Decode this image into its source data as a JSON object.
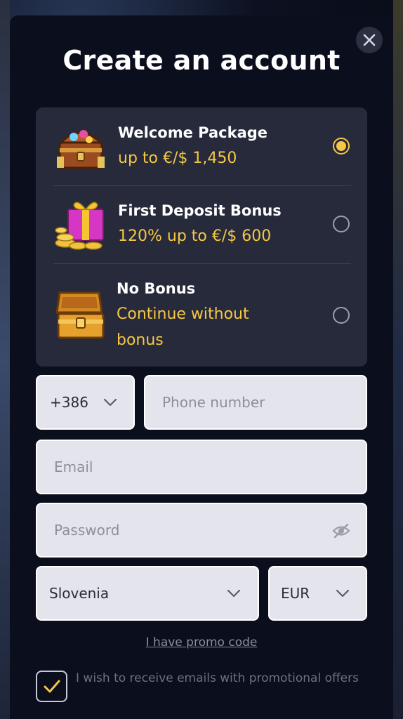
{
  "title": "Create an account",
  "bonuses": [
    {
      "title": "Welcome Package",
      "subtitle": "up to €/$ 1,450",
      "selected": true,
      "icon": "treasure-chest-gems-icon"
    },
    {
      "title": "First Deposit Bonus",
      "subtitle": "120% up to €/$ 600",
      "selected": false,
      "icon": "gift-box-coins-icon"
    },
    {
      "title": "No Bonus",
      "subtitle_line1": "Continue without",
      "subtitle_line2": "bonus",
      "selected": false,
      "icon": "open-chest-icon"
    }
  ],
  "phone": {
    "country_code": "+386",
    "placeholder": "Phone number"
  },
  "email": {
    "placeholder": "Email"
  },
  "password": {
    "placeholder": "Password"
  },
  "country": {
    "value": "Slovenia"
  },
  "currency": {
    "value": "EUR"
  },
  "promo_link": "I have promo code",
  "consent": {
    "checked": true,
    "text": "I wish to receive emails with promotional offers"
  },
  "colors": {
    "accent": "#f6c744",
    "modal_bg": "#0b0e1c",
    "card_bg": "#272a3b",
    "field_bg": "#e4e5ec"
  }
}
